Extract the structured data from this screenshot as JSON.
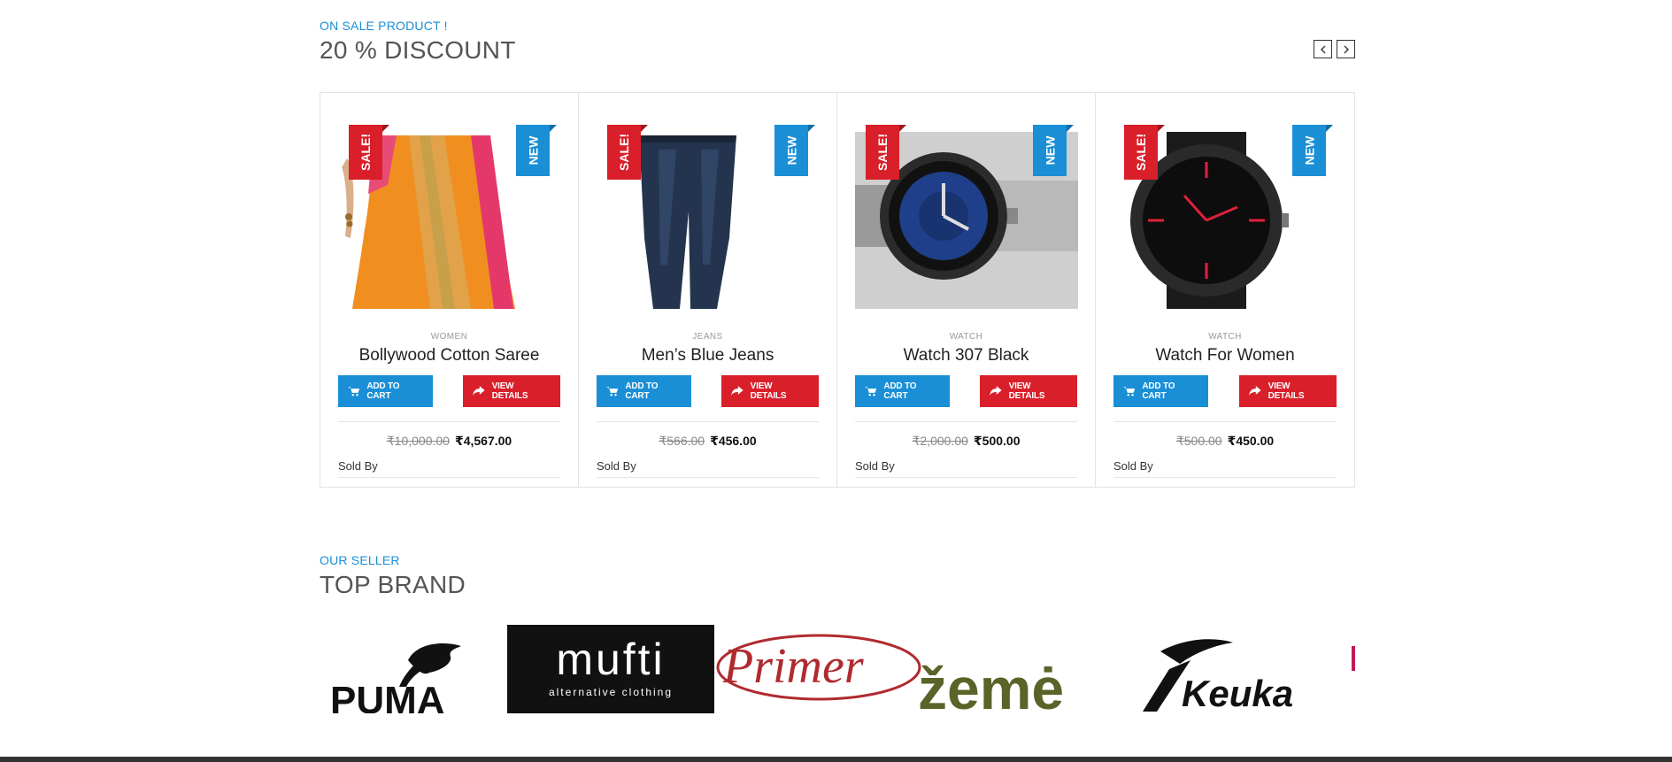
{
  "sale_section": {
    "eyebrow": "ON SALE PRODUCT !",
    "title": "20 % DISCOUNT",
    "prev_icon": "chevron-left-icon",
    "next_icon": "chevron-right-icon"
  },
  "badges": {
    "sale": "SALE!",
    "new": "NEW"
  },
  "buttons": {
    "cart": "ADD TO CART",
    "view": "VIEW DETAILS"
  },
  "sold_by_label": "Sold By",
  "products": [
    {
      "category": "WOMEN",
      "name": "Bollywood Cotton Saree",
      "old_price": "₹10,000.00",
      "new_price": "₹4,567.00",
      "image": "saree-image"
    },
    {
      "category": "JEANS",
      "name": "Men’s Blue Jeans",
      "old_price": "₹566.00",
      "new_price": "₹456.00",
      "image": "jeans-image"
    },
    {
      "category": "WATCH",
      "name": "Watch 307 Black",
      "old_price": "₹2,000.00",
      "new_price": "₹500.00",
      "image": "watch-steel-image"
    },
    {
      "category": "WATCH",
      "name": "Watch For Women",
      "old_price": "₹500.00",
      "new_price": "₹450.00",
      "image": "watch-black-red-image"
    }
  ],
  "brand_section": {
    "eyebrow": "OUR SELLER",
    "title": "TOP BRAND",
    "brands": [
      "PUMA",
      "mufti",
      "alternative clothing",
      "Primer",
      "žemė",
      "Keuka"
    ]
  },
  "colors": {
    "accent_blue": "#1a8fd6",
    "accent_red": "#d91f2a",
    "footer": "#333333"
  }
}
